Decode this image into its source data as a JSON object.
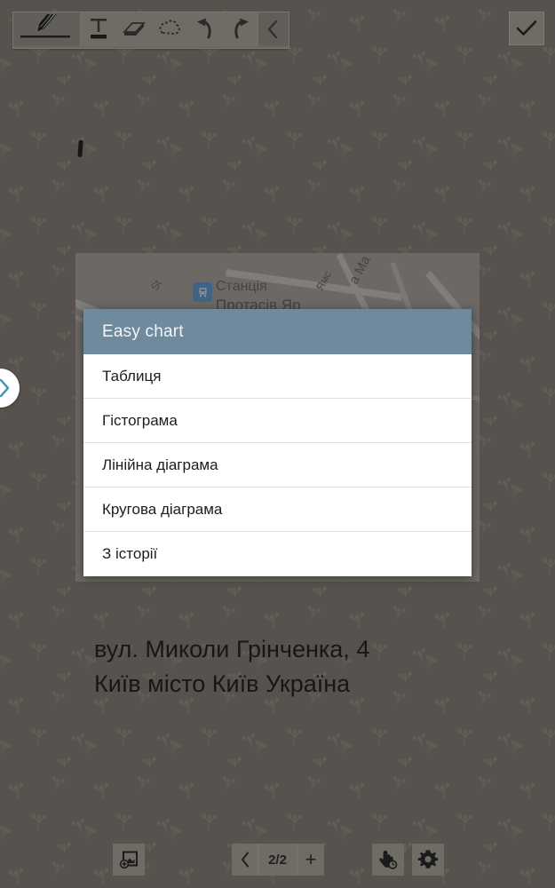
{
  "app": {
    "background_color": "#57524d",
    "accent_color": "#6f899d"
  },
  "toolbar": {
    "tools": [
      {
        "name": "pen-tool",
        "icon": "pen-icon",
        "selected": true
      },
      {
        "name": "text-tool",
        "icon": "text-t-icon",
        "selected": false
      },
      {
        "name": "eraser-tool",
        "icon": "eraser-icon",
        "selected": false
      },
      {
        "name": "lasso-select-tool",
        "icon": "lasso-icon",
        "selected": false
      },
      {
        "name": "undo-tool",
        "icon": "undo-arrow-icon",
        "selected": false
      },
      {
        "name": "redo-tool",
        "icon": "redo-arrow-icon",
        "selected": false
      },
      {
        "name": "collapse-toolbar",
        "icon": "chevron-left-icon",
        "selected": false
      }
    ],
    "confirm": {
      "name": "confirm-button",
      "icon": "checkmark-icon"
    }
  },
  "left_expander": {
    "icon": "chevron-right-icon"
  },
  "annotation": {
    "ink_mark": "ink-stroke"
  },
  "map": {
    "station_label_top": "Станція",
    "station_label_bottom": "Протасів Яр",
    "station_icon": "train-station-icon",
    "street_label_1": "St",
    "street_label_2": "Ямс",
    "street_label_3": "а Ма"
  },
  "dialog": {
    "title": "Easy chart",
    "items": [
      {
        "label": "Таблиця"
      },
      {
        "label": "Гістограма"
      },
      {
        "label": "Лінійна діаграма"
      },
      {
        "label": "Кругова діаграма"
      },
      {
        "label": "З історії"
      }
    ]
  },
  "address": {
    "line1": "вул. Миколи Грінченка, 4",
    "line2": "Київ місто Київ Україна"
  },
  "bottom_bar": {
    "add_image": {
      "name": "add-image-button",
      "icon": "add-image-icon"
    },
    "pager": {
      "prev_icon": "chevron-left-icon",
      "count": "2/2",
      "next_label": "+"
    },
    "pointer_tool": {
      "name": "pointer-tool-button",
      "icon": "hand-pointer-clock-icon"
    },
    "settings": {
      "name": "settings-button",
      "icon": "gear-icon"
    }
  }
}
